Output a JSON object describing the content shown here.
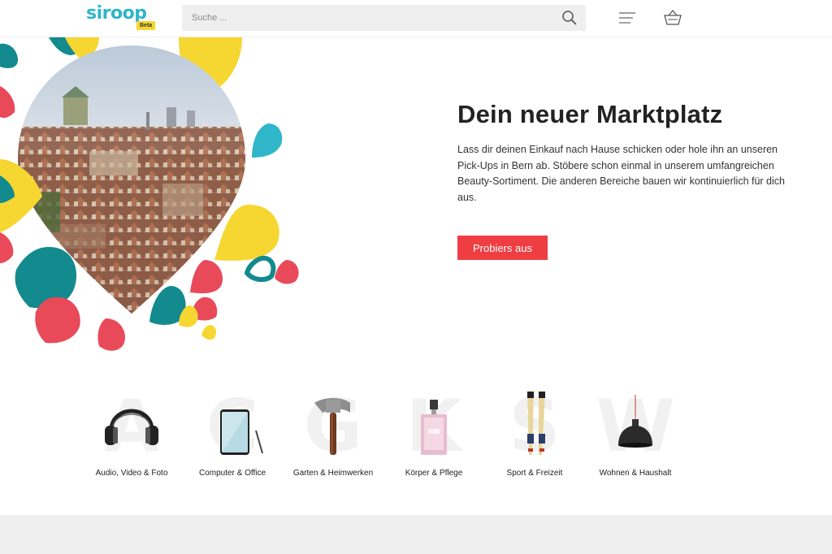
{
  "header": {
    "logo_text": "siroop",
    "logo_badge": "Beta",
    "search_placeholder": "Suche ...",
    "icons": {
      "search": "search-icon",
      "menu": "menu-icon",
      "basket": "basket-icon"
    }
  },
  "hero": {
    "title": "Dein neuer Marktplatz",
    "text": "Lass dir deinen Einkauf nach Hause schicken oder hole ihn an unseren Pick-Ups in Bern ab. Stöbere schon einmal in unserem umfangreichen Beauty-Sortiment. Die anderen Bereiche bauen wir kontinuierlich für dich aus.",
    "cta_label": "Probiers aus"
  },
  "categories": [
    {
      "letter": "A",
      "label": "Audio, Video & Foto",
      "icon": "headphones-icon"
    },
    {
      "letter": "C",
      "label": "Computer & Office",
      "icon": "tablet-icon"
    },
    {
      "letter": "G",
      "label": "Garten & Heimwerken",
      "icon": "hammer-icon"
    },
    {
      "letter": "K",
      "label": "Körper & Pflege",
      "icon": "perfume-icon"
    },
    {
      "letter": "S",
      "label": "Sport & Freizeit",
      "icon": "ski-icon"
    },
    {
      "letter": "W",
      "label": "Wohnen & Haushalt",
      "icon": "lamp-icon"
    }
  ],
  "colors": {
    "brand": "#2fb6c9",
    "accent": "#ef3e42",
    "yellow": "#f6d631",
    "teal": "#138a8d"
  }
}
